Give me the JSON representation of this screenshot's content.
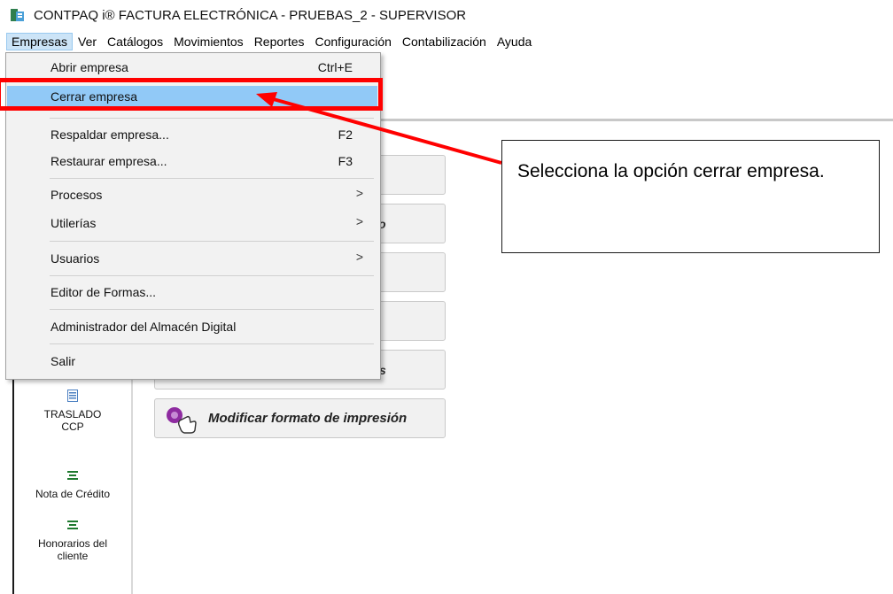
{
  "window": {
    "title": "CONTPAQ i® FACTURA ELECTRÓNICA  -  PRUEBAS_2  -  SUPERVISOR"
  },
  "menubar": {
    "items": [
      "Empresas",
      "Ver",
      "Catálogos",
      "Movimientos",
      "Reportes",
      "Configuración",
      "Contabilización",
      "Ayuda"
    ],
    "active": "Empresas"
  },
  "dropdown": {
    "abrir": {
      "label": "Abrir empresa",
      "shortcut": "Ctrl+E"
    },
    "cerrar": {
      "label": "Cerrar empresa"
    },
    "respaldar": {
      "label": "Respaldar empresa...",
      "shortcut": "F2"
    },
    "restaurar": {
      "label": "Restaurar empresa...",
      "shortcut": "F3"
    },
    "procesos": {
      "label": "Procesos",
      "arrow": ">"
    },
    "utilerias": {
      "label": "Utilerías",
      "arrow": ">"
    },
    "usuarios": {
      "label": "Usuarios",
      "arrow": ">"
    },
    "editor": {
      "label": "Editor de Formas..."
    },
    "almacen": {
      "label": "Administrador del Almacén Digital"
    },
    "salir": {
      "label": "Salir"
    }
  },
  "left_panel": {
    "items": [
      {
        "label_line1": "TRASLADO",
        "label_line2": "CCP",
        "icon": "document-icon"
      },
      {
        "label_line1": "Nota de Crédito",
        "label_line2": "",
        "icon": "list-icon"
      },
      {
        "label_line1": "Honorarios del",
        "label_line2": "cliente",
        "icon": "list-icon"
      }
    ]
  },
  "buttons": {
    "partial_label_1": "o",
    "partial_label_2": "s",
    "modificar_formato": "Modificar formato de impresión"
  },
  "annotation": {
    "callout_text": "Selecciona la opción cerrar empresa.",
    "highlight_color": "#ff0000"
  },
  "colors": {
    "menu_highlight": "#91c9f7",
    "menubar_active": "#cce4f7",
    "icon_accent": "#8e2ba0"
  }
}
